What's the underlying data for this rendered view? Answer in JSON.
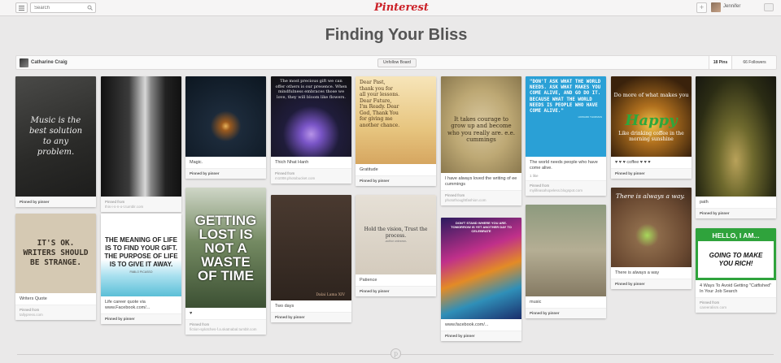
{
  "header": {
    "search_placeholder": "Search",
    "logo": "Pinterest",
    "user_name": "Jennifer"
  },
  "board": {
    "title": "Finding Your Bliss",
    "owner": "Catharine Craig",
    "unfollow_label": "Unfollow Board",
    "pins_count": "18 Pins",
    "followers_count": "66 Followers"
  },
  "pins": {
    "p1": {
      "desc": "",
      "by": "Pinned by pinner",
      "from": "",
      "src": "",
      "img_text": "Music is the best solution to any problem."
    },
    "p2": {
      "desc": "",
      "by": "",
      "from": "Pinned from",
      "src": "this-i-s-n-o-t.tumblr.com",
      "img_text": ""
    },
    "p3": {
      "desc": "Magic.",
      "by": "Pinned by pinner",
      "from": "",
      "src": "",
      "img_text": ""
    },
    "p4": {
      "desc": "Thich Nhat Hanh",
      "by": "",
      "from": "Pinned from",
      "src": "m1008.photobucket.com",
      "img_text": "The most precious gift we can offer others is our presence. When mindfulness embraces those we love, they will bloom like flowers."
    },
    "p5": {
      "desc": "Gratitude",
      "by": "Pinned by pinner",
      "from": "",
      "src": "",
      "img_text": "Dear Past, thank you for all your lessons. Dear Future, I'm Ready. Dear God, Thank You for giving me another chance."
    },
    "p6": {
      "desc": "I have always loved the writing of ee cummings",
      "by": "",
      "from": "Pinned from",
      "src": "photothoughtfashion.com",
      "img_text": "It takes courage to grow up and become who you really are. e.e. cummings"
    },
    "p7": {
      "desc": "The world needs people who have come alive.",
      "likes": "1 like",
      "by": "",
      "from": "Pinned from",
      "src": "mylifeasahopeless.blogspot.com",
      "img_text": "\"DON'T ASK WHAT THE WORLD NEEDS. ASK WHAT MAKES YOU COME ALIVE, AND GO DO IT. BECAUSE WHAT THE WORLD NEEDS IS PEOPLE WHO HAVE COME ALIVE.\"",
      "img_attr": "HOWARD THURMAN"
    },
    "p8": {
      "desc": "♥ ♥ ♥ coffee ♥ ♥ ♥",
      "by": "Pinned by pinner",
      "from": "",
      "src": "",
      "img_top": "Do more of what makes you",
      "img_big": "Happy",
      "img_bottom": "Like drinking coffee in the morning sunshine"
    },
    "p9": {
      "desc": "path",
      "by": "Pinned by pinner",
      "from": "",
      "src": "",
      "img_text": ""
    },
    "p10": {
      "desc": "Writers Quote",
      "by": "",
      "from": "Pinned from",
      "src": "tallypress.com",
      "img_text": "IT'S OK. WRITERS SHOULD BE STRANGE."
    },
    "p11": {
      "desc": "Life career quote via www.Facebook.com/...",
      "by": "Pinned by pinner",
      "from": "",
      "src": "",
      "img_text": "THE MEANING OF LIFE IS TO FIND YOUR GIFT. THE PURPOSE OF LIFE IS TO GIVE IT AWAY.",
      "img_attr": "PABLO PICASSO"
    },
    "p12": {
      "desc": "♥",
      "by": "",
      "from": "Pinned from",
      "src": "fiction-splotches-f.a.skatnabal.tumblr.com",
      "img_text": "GETTING LOST IS NOT A WASTE OF TIME"
    },
    "p13": {
      "desc": "Two days",
      "by": "Pinned by pinner",
      "from": "",
      "src": "",
      "img_text": "Dalai Lama XIV"
    },
    "p14": {
      "desc": "Patience",
      "by": "Pinned by pinner",
      "from": "",
      "src": "",
      "img_text": "Hold the vision, Trust the process.",
      "img_attr": "-author unknown-"
    },
    "p15": {
      "desc": "www.facebook.com/...",
      "by": "Pinned by pinner",
      "from": "",
      "src": "",
      "img_text": "DON'T STAND WHERE YOU ARE. TOMORROW IS YET ANOTHER DAY TO CELEBRATE"
    },
    "p16": {
      "desc": "music",
      "by": "Pinned by pinner",
      "from": "",
      "src": "",
      "img_text": ""
    },
    "p17": {
      "desc": "There is always a way",
      "by": "Pinned by pinner",
      "from": "",
      "src": "",
      "img_text": "There is always a way."
    },
    "p18": {
      "desc": "4 Ways To Avoid Getting \"Catfished\" In Your Job Search",
      "by": "",
      "from": "Pinned from",
      "src": "careeralism.com",
      "img_top": "HELLO, I AM...",
      "img_text": "GOING TO MAKE YOU RICH!"
    }
  }
}
